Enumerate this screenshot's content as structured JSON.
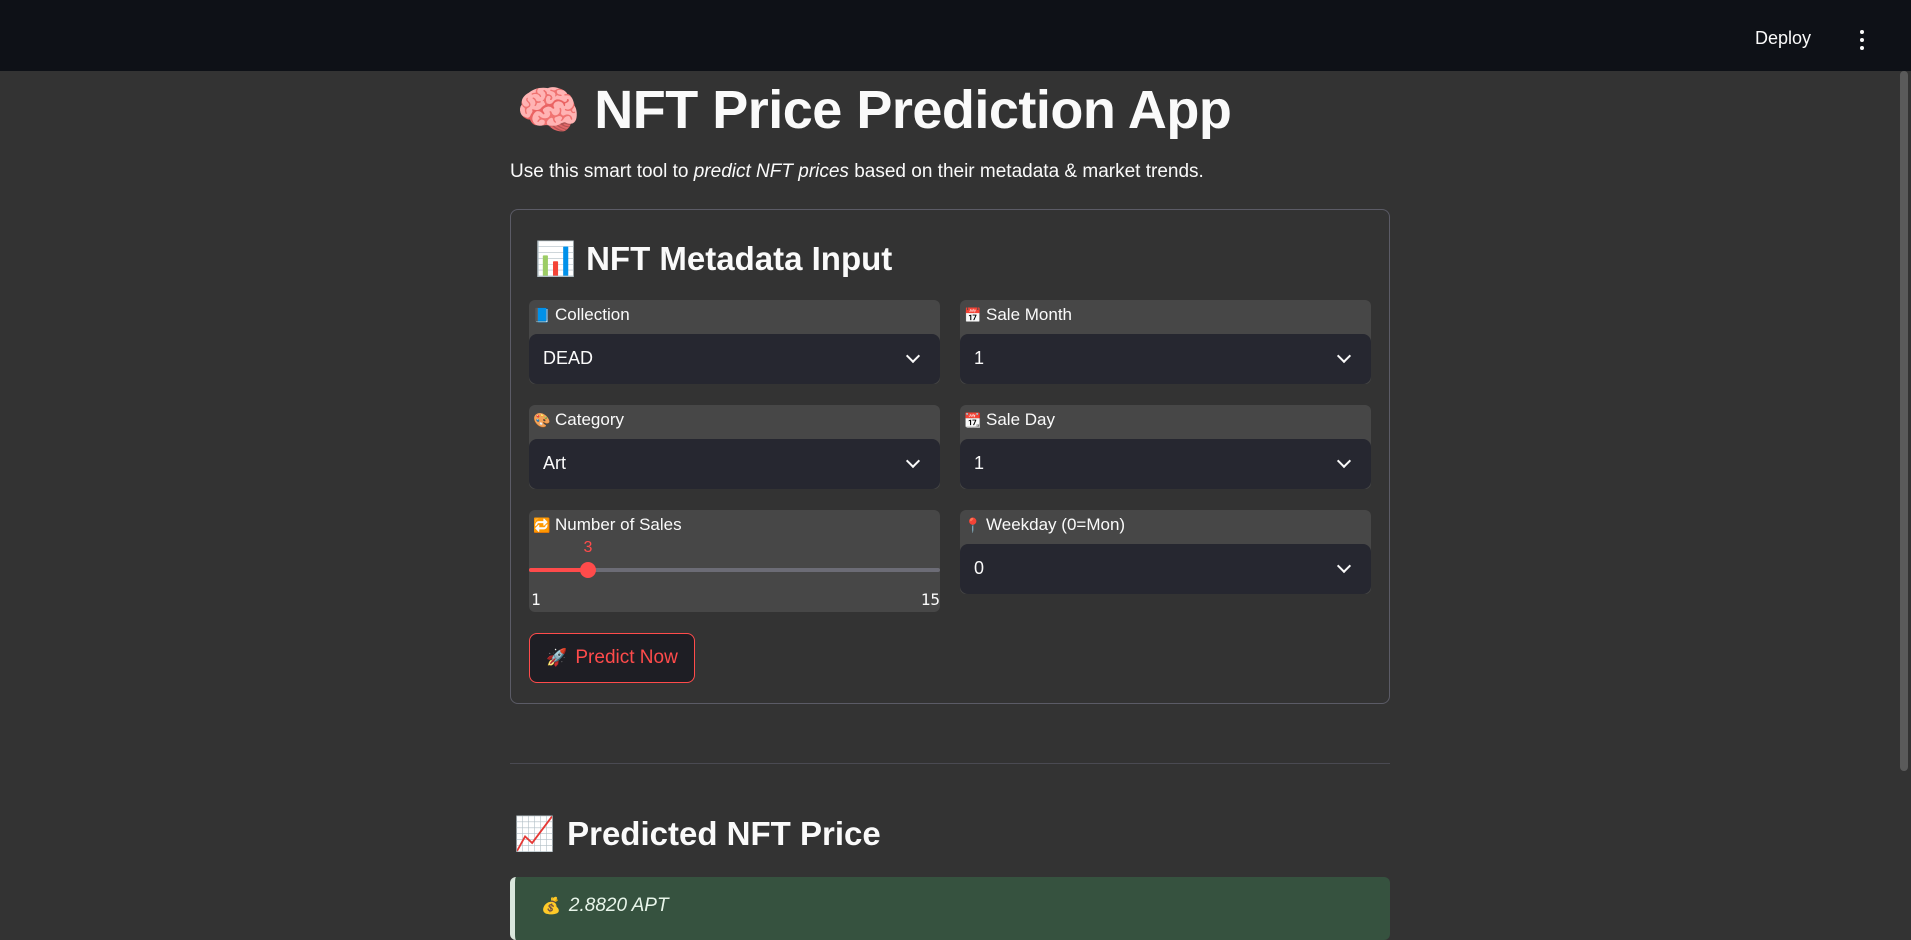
{
  "header": {
    "deploy_label": "Deploy"
  },
  "main": {
    "title": "NFT Price Prediction App",
    "title_emoji": "🧠",
    "subtitle_before": "Use this smart tool to ",
    "subtitle_emphasis": "predict NFT prices",
    "subtitle_after": " based on their metadata & market trends."
  },
  "form": {
    "title": "NFT Metadata Input",
    "title_emoji": "📊",
    "collection": {
      "icon": "📘",
      "label": "Collection",
      "value": "DEAD"
    },
    "sale_month": {
      "icon": "📅",
      "label": "Sale Month",
      "value": "1"
    },
    "category": {
      "icon": "🎨",
      "label": "Category",
      "value": "Art"
    },
    "sale_day": {
      "icon": "📆",
      "label": "Sale Day",
      "value": "1"
    },
    "num_sales": {
      "icon": "🔁",
      "label": "Number of Sales",
      "value": 3,
      "value_text": "3",
      "min": 1,
      "max": 15,
      "min_text": "1",
      "max_text": "15"
    },
    "weekday": {
      "icon": "📍",
      "label": "Weekday (0=Mon)",
      "value": "0"
    },
    "predict_button": {
      "emoji": "🚀",
      "label": "Predict Now"
    }
  },
  "result": {
    "title": "Predicted NFT Price",
    "title_emoji": "📈",
    "emoji": "💰",
    "value": "2.8820 APT"
  },
  "colors": {
    "accent": "#ff4b4b",
    "background": "#333333",
    "topbar": "#0e1117",
    "success_bg": "#36523f"
  }
}
